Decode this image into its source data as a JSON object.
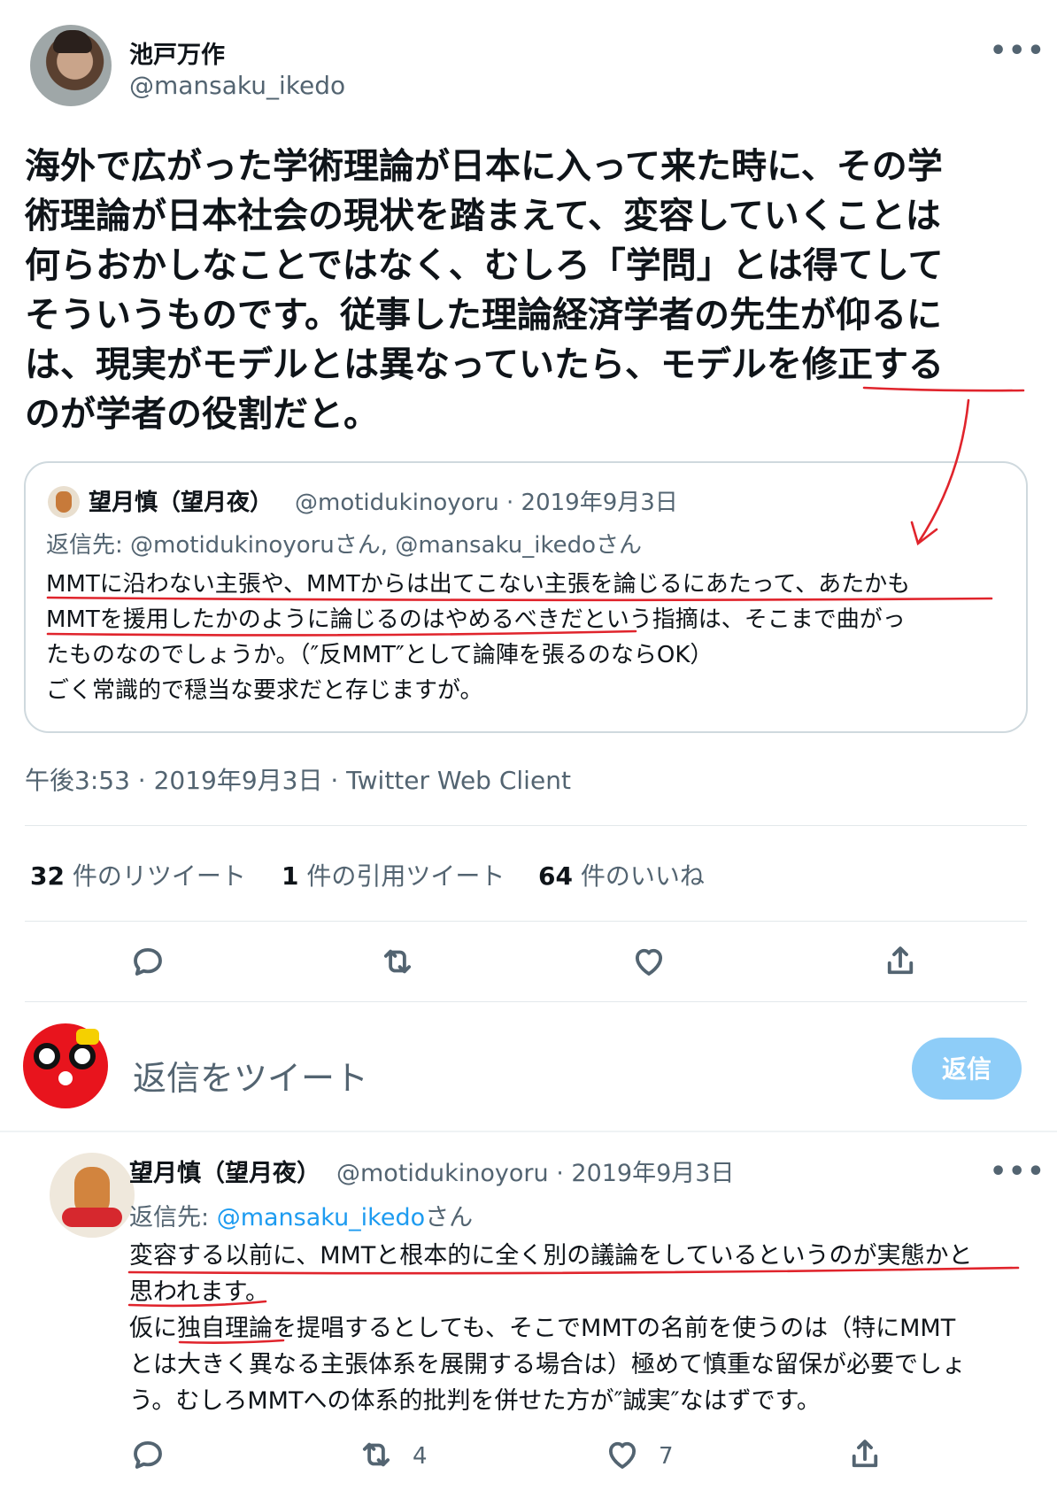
{
  "tweet": {
    "author_name": "池戸万作",
    "author_handle": "@mansaku_ikedo",
    "more_label": "•••",
    "text_lines": [
      "海外で広がった学術理論が日本に入って来た時に、その学",
      "術理論が日本社会の現状を踏まえて、変容していくことは",
      "何らおかしなことではなく、むしろ「学問」とは得てして",
      "そういうものです。従事した理論経済学者の先生が仰るに",
      "は、現実がモデルとは異なっていたら、モデルを修正する",
      "のが学者の役割だと。"
    ],
    "quote": {
      "author_name": "望月慎（望月夜）",
      "author_meta": "@motidukinoyoru · 2019年9月3日",
      "reply_to": "返信先: @motidukinoyoruさん, @mansaku_ikedoさん",
      "text_lines": [
        "MMTに沿わない主張や、MMTからは出てこない主張を論じるにあたって、あたかも",
        "MMTを援用したかのように論じるのはやめるべきだという指摘は、そこまで曲がっ",
        "たものなのでしょうか。（″反MMT″として論陣を張るのならOK）",
        "ごく常識的で穏当な要求だと存じますが。"
      ]
    },
    "timestamp": "午後3:53 · 2019年9月3日 · Twitter Web Client",
    "stats": {
      "retweets_count": "32",
      "retweets_label": " 件のリツイート",
      "quotes_count": "1",
      "quotes_label": " 件の引用ツイート",
      "likes_count": "64",
      "likes_label": " 件のいいね"
    }
  },
  "compose": {
    "placeholder": "返信をツイート",
    "button_label": "返信"
  },
  "reply": {
    "author_name": "望月慎（望月夜）",
    "author_meta": "@motidukinoyoru · 2019年9月3日",
    "reply_prefix": "返信先: ",
    "reply_handle": "@mansaku_ikedo",
    "reply_suffix": "さん",
    "more_label": "•••",
    "text_lines": [
      "変容する以前に、MMTと根本的に全く別の議論をしているというのが実態かと",
      "思われます。",
      "仮に独自理論を提唱するとしても、そこでMMTの名前を使うのは（特にMMT",
      "とは大きく異なる主張体系を展開する場合は）極めて慎重な留保が必要でしょ",
      "う。むしろMMTへの体系的批判を併せた方が″誠実″なはずです。"
    ],
    "retweet_count": "4",
    "like_count": "7"
  },
  "colors": {
    "accent": "#1d9bf0",
    "reply_button": "#8ecdf8",
    "annotation": "#e0242c",
    "secondary_text": "#536471"
  },
  "icons": [
    "reply-icon",
    "retweet-icon",
    "like-icon",
    "share-icon",
    "more-icon"
  ]
}
